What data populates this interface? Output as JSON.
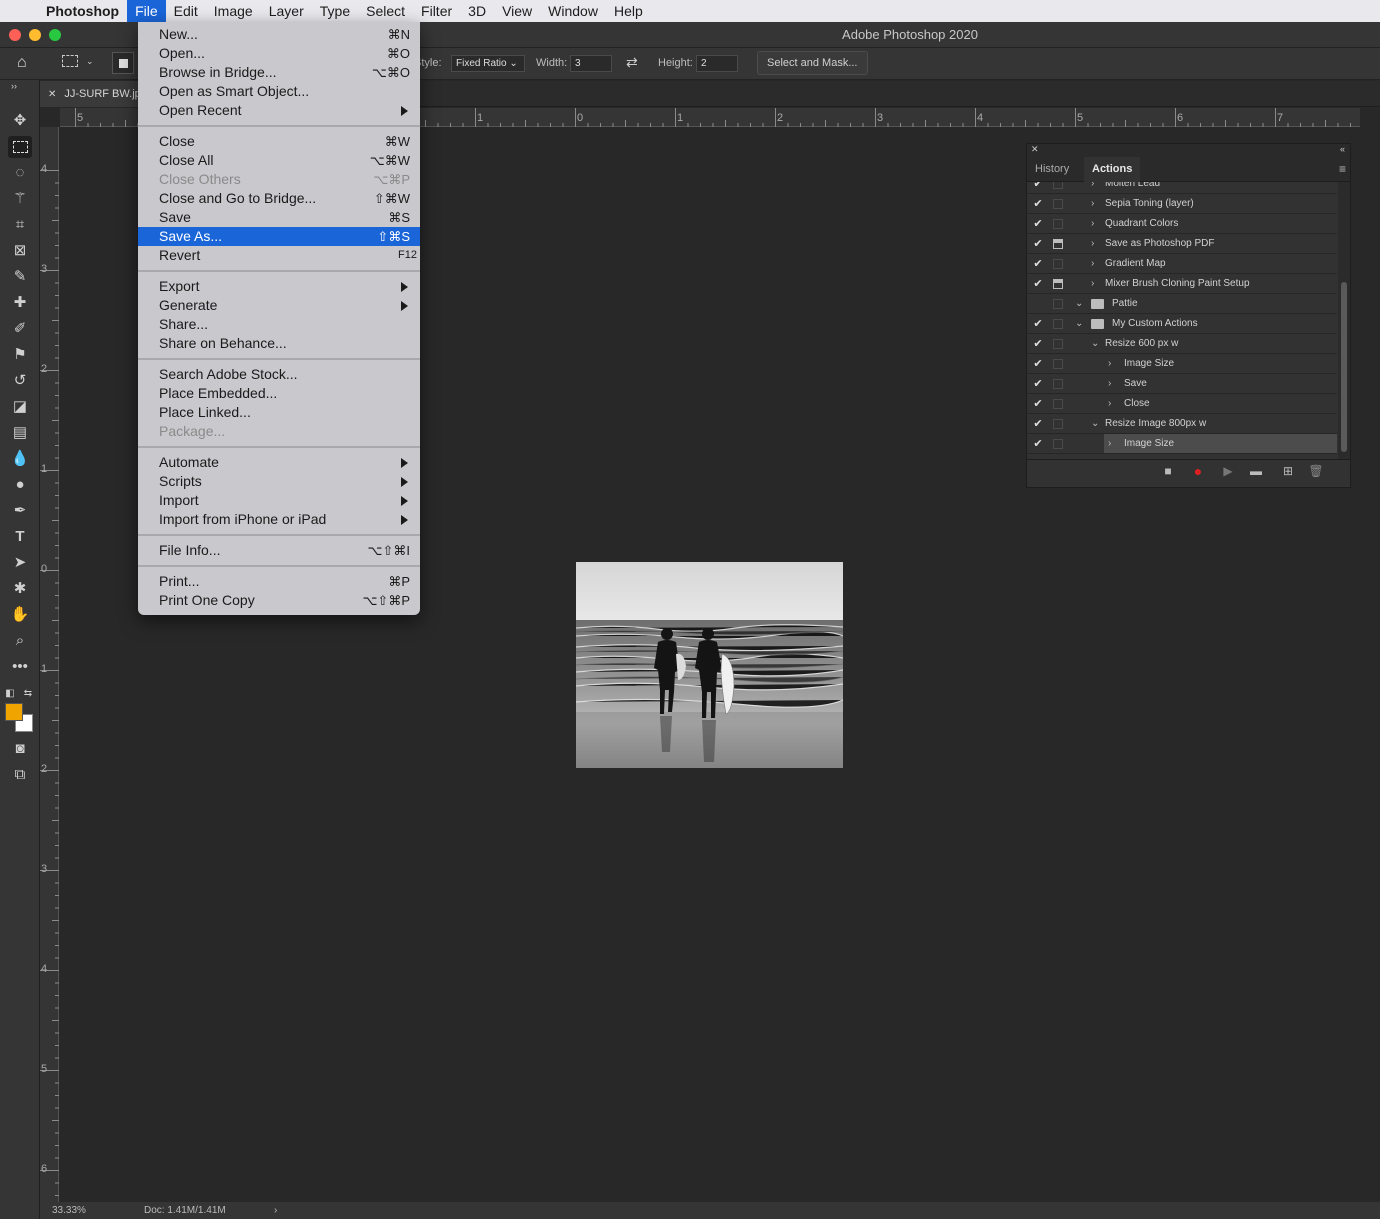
{
  "menubar": {
    "app": "Photoshop",
    "items": [
      "File",
      "Edit",
      "Image",
      "Layer",
      "Type",
      "Select",
      "Filter",
      "3D",
      "View",
      "Window",
      "Help"
    ]
  },
  "window": {
    "title": "Adobe Photoshop 2020"
  },
  "options": {
    "style_label": "Style:",
    "style_value": "Fixed Ratio",
    "width_label": "Width:",
    "width_value": "3",
    "height_label": "Height:",
    "height_value": "2",
    "select_mask": "Select and Mask..."
  },
  "document": {
    "tab": "JJ-SURF BW.jpg"
  },
  "rulers": {
    "top": [
      "5",
      "1",
      "0",
      "1",
      "2",
      "3",
      "4",
      "5",
      "6",
      "7"
    ],
    "left": [
      "4",
      "3",
      "2",
      "1",
      "0",
      "1",
      "2",
      "3",
      "4",
      "5",
      "6"
    ]
  },
  "file_menu": {
    "items": [
      {
        "label": "New...",
        "shortcut": "⌘N"
      },
      {
        "label": "Open...",
        "shortcut": "⌘O"
      },
      {
        "label": "Browse in Bridge...",
        "shortcut": "⌥⌘O"
      },
      {
        "label": "Open as Smart Object...",
        "shortcut": ""
      },
      {
        "label": "Open Recent",
        "shortcut": ""
      },
      {
        "label": "Close",
        "shortcut": "⌘W"
      },
      {
        "label": "Close All",
        "shortcut": "⌥⌘W"
      },
      {
        "label": "Close Others",
        "shortcut": "⌥⌘P"
      },
      {
        "label": "Close and Go to Bridge...",
        "shortcut": "⇧⌘W"
      },
      {
        "label": "Save",
        "shortcut": "⌘S"
      },
      {
        "label": "Save As...",
        "shortcut": "⇧⌘S"
      },
      {
        "label": "Revert",
        "shortcut": "F12"
      },
      {
        "label": "Export",
        "shortcut": ""
      },
      {
        "label": "Generate",
        "shortcut": ""
      },
      {
        "label": "Share...",
        "shortcut": ""
      },
      {
        "label": "Share on Behance...",
        "shortcut": ""
      },
      {
        "label": "Search Adobe Stock...",
        "shortcut": ""
      },
      {
        "label": "Place Embedded...",
        "shortcut": ""
      },
      {
        "label": "Place Linked...",
        "shortcut": ""
      },
      {
        "label": "Package...",
        "shortcut": ""
      },
      {
        "label": "Automate",
        "shortcut": ""
      },
      {
        "label": "Scripts",
        "shortcut": ""
      },
      {
        "label": "Import",
        "shortcut": ""
      },
      {
        "label": "Import from iPhone or iPad",
        "shortcut": ""
      },
      {
        "label": "File Info...",
        "shortcut": "⌥⇧⌘I"
      },
      {
        "label": "Print...",
        "shortcut": "⌘P"
      },
      {
        "label": "Print One Copy",
        "shortcut": "⌥⇧⌘P"
      }
    ]
  },
  "actions_panel": {
    "tabs": [
      "History",
      "Actions"
    ],
    "rows": [
      {
        "label": "Molten Lead",
        "checked": true,
        "dialog": false
      },
      {
        "label": "Sepia Toning (layer)",
        "checked": true,
        "dialog": false
      },
      {
        "label": "Quadrant Colors",
        "checked": true,
        "dialog": false
      },
      {
        "label": "Save as Photoshop PDF",
        "checked": true,
        "dialog": true
      },
      {
        "label": "Gradient Map",
        "checked": true,
        "dialog": false
      },
      {
        "label": "Mixer Brush Cloning Paint Setup",
        "checked": true,
        "dialog": true
      },
      {
        "label": "Pattie",
        "checked": false,
        "dialog": false
      },
      {
        "label": "My Custom Actions",
        "checked": true,
        "dialog": false
      },
      {
        "label": "Resize 600 px w",
        "checked": true,
        "dialog": false
      },
      {
        "label": "Image Size",
        "checked": true,
        "dialog": false
      },
      {
        "label": "Save",
        "checked": true,
        "dialog": false
      },
      {
        "label": "Close",
        "checked": true,
        "dialog": false
      },
      {
        "label": "Resize Image 800px w",
        "checked": true,
        "dialog": false
      },
      {
        "label": "Image Size",
        "checked": true,
        "dialog": false
      }
    ]
  },
  "status": {
    "zoom": "33.33%",
    "doc": "Doc: 1.41M/1.41M"
  },
  "colors": {
    "foreground": "#f0a400",
    "background": "#ffffff",
    "highlight": "#1a65d8"
  }
}
